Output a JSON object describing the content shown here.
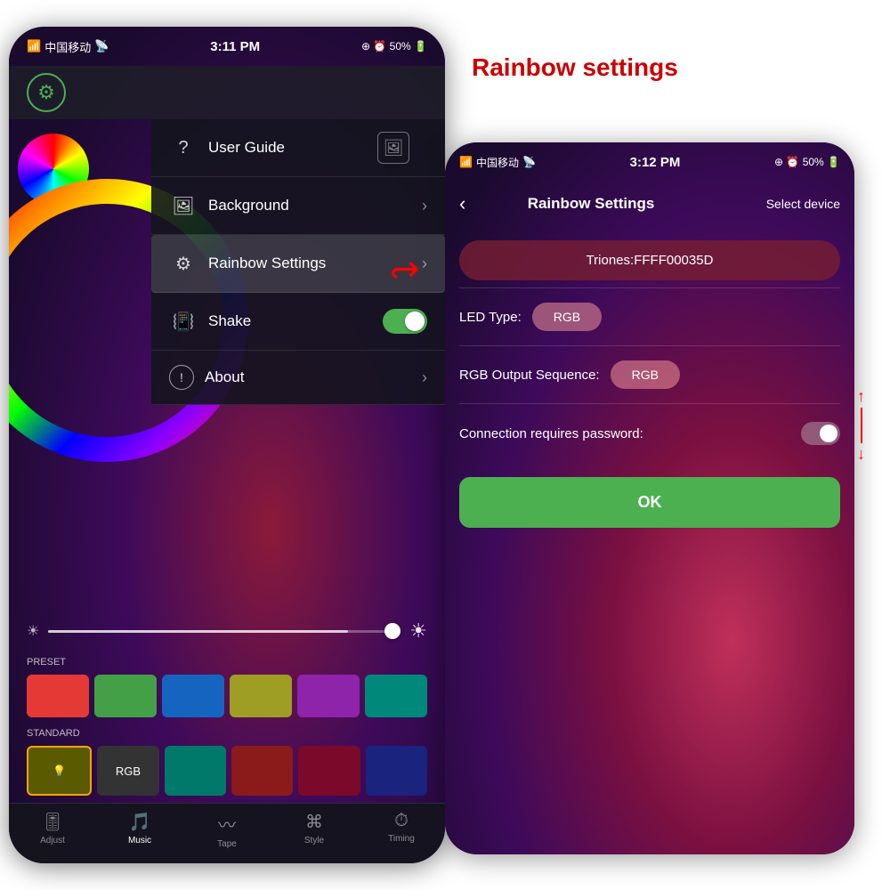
{
  "header": {
    "title": "Rainbow settings"
  },
  "left_phone": {
    "status_bar": {
      "carrier": "中国移动",
      "wifi": "WiFi",
      "time": "3:11 PM",
      "icons_right": "⊕ ⏰ 50%"
    },
    "menu": {
      "items": [
        {
          "id": "user-guide",
          "icon": "?",
          "label": "User Guide",
          "has_arrow": true,
          "has_image_icon": true
        },
        {
          "id": "background",
          "icon": "🖼",
          "label": "Background",
          "has_arrow": true
        },
        {
          "id": "rainbow-settings",
          "icon": "⚙",
          "label": "Rainbow Settings",
          "has_arrow": true,
          "highlighted": true
        },
        {
          "id": "shake",
          "icon": "📳",
          "label": "Shake",
          "has_toggle": true,
          "toggle_on": true
        },
        {
          "id": "about",
          "icon": "!",
          "label": "About",
          "has_arrow": true
        }
      ]
    },
    "brightness_slider": {
      "min_icon": "☀",
      "max_icon": "☀",
      "value": 85
    },
    "preset": {
      "label": "PRESET",
      "colors": [
        "#E53935",
        "#43A047",
        "#1565C0",
        "#9E9D24",
        "#8E24AA",
        "#00897B"
      ]
    },
    "standard": {
      "label": "STANDARD",
      "items": [
        {
          "icon": "💡",
          "bg": "#7B7B00",
          "active": true
        },
        {
          "label": "RGB",
          "bg": "#444",
          "active": false
        },
        {
          "bg": "#00796B",
          "active": false
        },
        {
          "bg": "#8B1A1A",
          "active": false
        },
        {
          "bg": "#8B1A1A",
          "active": false
        },
        {
          "bg": "#1A237E",
          "active": false
        }
      ]
    },
    "bottom_nav": [
      {
        "icon": "🎚",
        "label": "Adjust",
        "active": false
      },
      {
        "icon": "🎵",
        "label": "Music",
        "active": true
      },
      {
        "icon": "〰",
        "label": "Tape",
        "active": false
      },
      {
        "icon": "⌘",
        "label": "Style",
        "active": false
      },
      {
        "icon": "⏱",
        "label": "Timing",
        "active": false
      }
    ]
  },
  "right_phone": {
    "status_bar": {
      "carrier": "中国移动",
      "wifi": "WiFi",
      "time": "3:12 PM",
      "icons_right": "⊕ ⏰ 50%"
    },
    "nav": {
      "title": "Rainbow Settings",
      "select_device": "Select device"
    },
    "device_name": "Triones:FFFF00035D",
    "led_type": {
      "label": "LED Type:",
      "value": "RGB"
    },
    "rgb_output": {
      "label": "RGB Output Sequence:",
      "value": "RGB"
    },
    "connection_password": {
      "label": "Connection requires password:",
      "toggle_on": false
    },
    "ok_button": "OK"
  }
}
